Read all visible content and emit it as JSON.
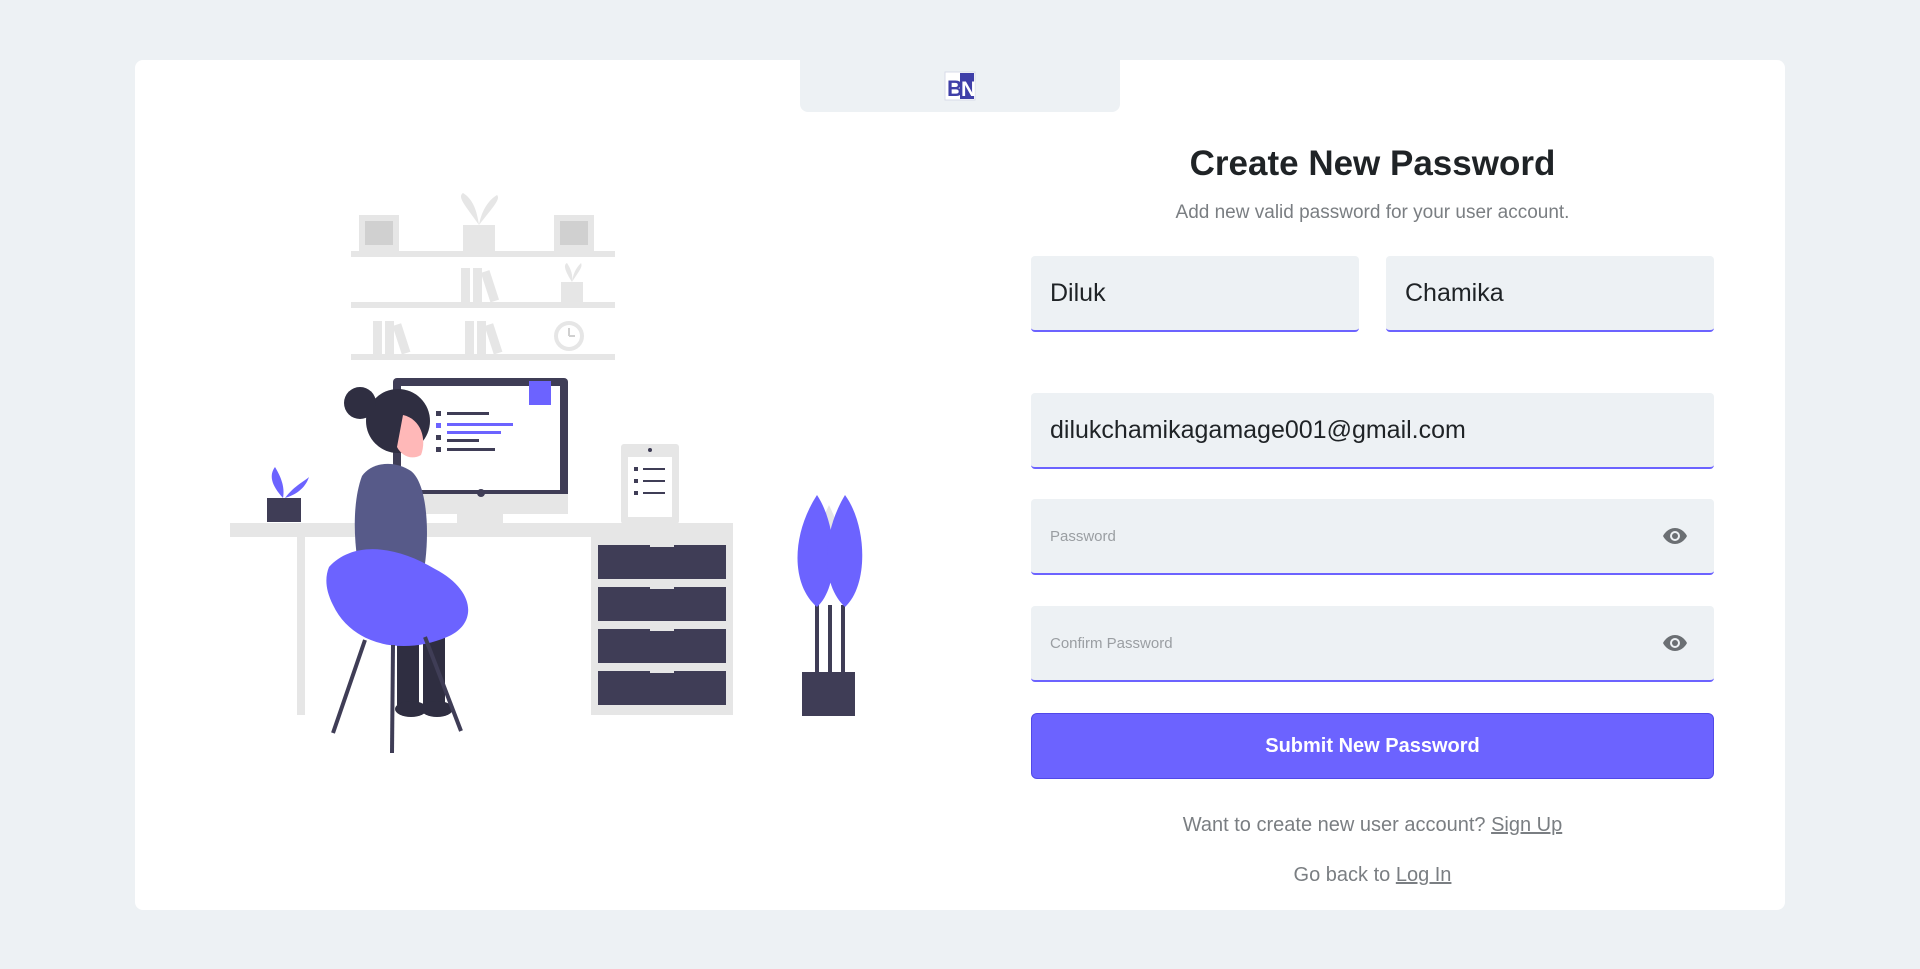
{
  "logo": {
    "text": "BN",
    "color": "#3f3fa8"
  },
  "form": {
    "title": "Create New Password",
    "subtitle": "Add new valid password for your user account.",
    "first_name_value": "Diluk",
    "last_name_value": "Chamika",
    "email_value": "dilukchamikagamage001@gmail.com",
    "password_placeholder": "Password",
    "confirm_password_placeholder": "Confirm Password",
    "submit_label": "Submit New Password"
  },
  "footer": {
    "signup_prompt": "Want to create new user account?",
    "signup_link": "Sign Up",
    "login_prompt": "Go back to",
    "login_link": "Log In"
  },
  "colors": {
    "accent": "#6c63ff",
    "background": "#edf1f4",
    "card": "#ffffff",
    "dark": "#3f3d56"
  },
  "icons": {
    "password_toggle": "eye-icon",
    "confirm_toggle": "eye-icon"
  }
}
